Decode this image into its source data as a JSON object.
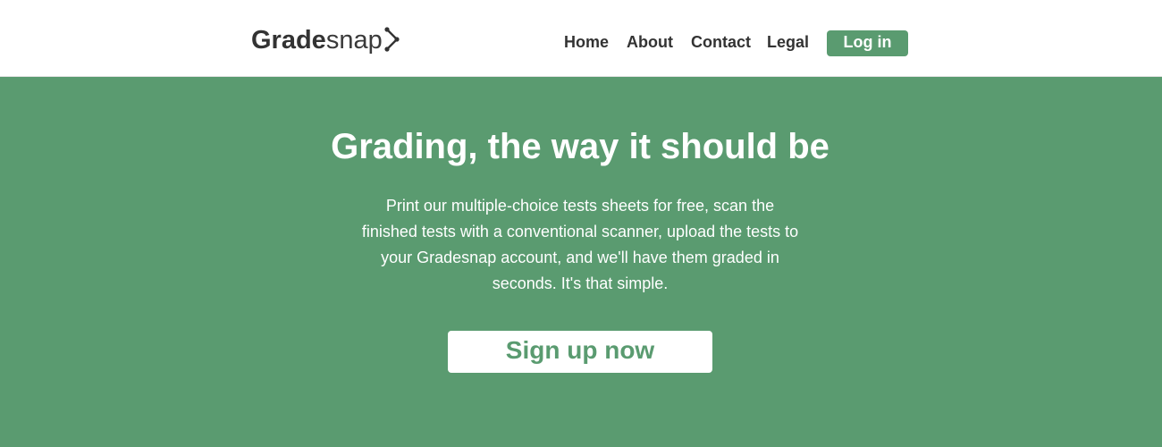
{
  "header": {
    "logo": {
      "bold_part": "Grade",
      "light_part": "snap",
      "icon": "share-nodes-icon"
    },
    "nav": {
      "items": [
        {
          "label": "Home"
        },
        {
          "label": "About"
        },
        {
          "label": "Contact"
        },
        {
          "label": "Legal"
        }
      ],
      "login_label": "Log in"
    }
  },
  "hero": {
    "title": "Grading, the way it should be",
    "description": "Print our multiple-choice tests sheets for free, scan the finished tests with a conventional scanner, upload the tests to your Gradesnap account, and we'll have them graded in seconds. It's that simple.",
    "cta_label": "Sign up now"
  },
  "colors": {
    "brand_green": "#5a9b70",
    "text_dark": "#333333",
    "white": "#ffffff"
  }
}
